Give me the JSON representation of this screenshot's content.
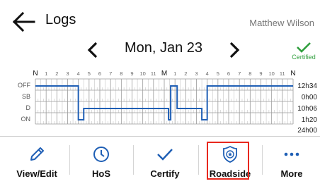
{
  "header": {
    "title": "Logs",
    "driver_name": "Matthew Wilson",
    "back_icon": "arrow-left-icon"
  },
  "date_nav": {
    "date": "Mon, Jan 23",
    "prev_icon": "chevron-left-icon",
    "next_icon": "chevron-right-icon"
  },
  "certification": {
    "status": "Certified",
    "icon": "checkmark-icon",
    "color": "#2e9e3c"
  },
  "log_graph": {
    "hour_labels": [
      "N",
      "1",
      "2",
      "3",
      "4",
      "5",
      "6",
      "7",
      "8",
      "9",
      "10",
      "11",
      "M",
      "1",
      "2",
      "3",
      "4",
      "5",
      "6",
      "7",
      "8",
      "9",
      "10",
      "11",
      "N"
    ],
    "status_rows": [
      "OFF",
      "SB",
      "D",
      "ON"
    ],
    "row_totals": [
      "12h34",
      "0h00",
      "10h06",
      "1h20"
    ],
    "grand_total": "24h00",
    "line_color": "#1f5fb5",
    "segments": [
      {
        "status": "OFF",
        "start_hour": 0.0,
        "end_hour": 4.0
      },
      {
        "status": "ON",
        "start_hour": 4.0,
        "end_hour": 4.5
      },
      {
        "status": "D",
        "start_hour": 4.5,
        "end_hour": 12.4
      },
      {
        "status": "ON",
        "start_hour": 12.4,
        "end_hour": 12.6
      },
      {
        "status": "OFF",
        "start_hour": 12.6,
        "end_hour": 13.2
      },
      {
        "status": "D",
        "start_hour": 13.2,
        "end_hour": 15.5
      },
      {
        "status": "ON",
        "start_hour": 15.5,
        "end_hour": 16.0
      },
      {
        "status": "OFF",
        "start_hour": 16.0,
        "end_hour": 24.0
      }
    ]
  },
  "toolbar": {
    "items": [
      {
        "label": "View/Edit",
        "icon": "pencil-icon"
      },
      {
        "label": "HoS",
        "icon": "clock-icon"
      },
      {
        "label": "Certify",
        "icon": "checkmark-icon"
      },
      {
        "label": "Roadside",
        "icon": "police-badge-icon"
      },
      {
        "label": "More",
        "icon": "more-dots-icon"
      }
    ],
    "highlighted": "Roadside",
    "highlight_color": "#e8281e",
    "icon_color": "#1f5fb5"
  }
}
